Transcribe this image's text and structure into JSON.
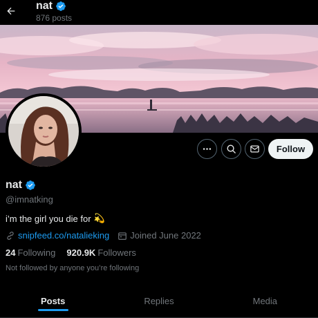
{
  "header": {
    "name": "nat",
    "posts_count": "876 posts",
    "back_icon": "arrow-left-icon"
  },
  "banner": {
    "theme": "pink-sunset-lake",
    "accent": "#e9a9c0"
  },
  "actions": {
    "more_icon": "ellipsis-icon",
    "search_icon": "search-icon",
    "message_icon": "envelope-icon",
    "follow_label": "Follow"
  },
  "profile": {
    "display_name": "nat",
    "verified_icon": "verified-badge-icon",
    "handle": "@imnatking",
    "bio": "i’m the girl you die for",
    "bio_emoji": "💫",
    "link": "snipfeed.co/natalieking",
    "joined": "Joined June 2022",
    "following_count": "24",
    "following_label": "Following",
    "followers_count": "920.9K",
    "followers_label": "Followers",
    "not_followed": "Not followed by anyone you’re following"
  },
  "tabs": [
    {
      "label": "Posts",
      "active": true
    },
    {
      "label": "Replies",
      "active": false
    },
    {
      "label": "Media",
      "active": false
    }
  ],
  "colors": {
    "accent": "#1d9bf0",
    "background": "#000000",
    "muted": "#71767b"
  }
}
